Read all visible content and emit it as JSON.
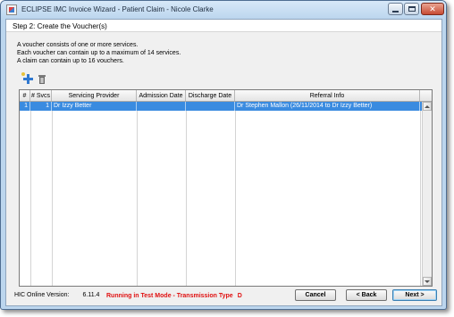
{
  "window": {
    "title": "ECLIPSE IMC Invoice Wizard - Patient Claim - Nicole Clarke",
    "controls": {
      "minimize": "minimize",
      "maximize": "maximize",
      "close": "close"
    }
  },
  "step": {
    "title": "Step 2: Create the Voucher(s)"
  },
  "description": [
    "A voucher consists of one or more services.",
    "Each voucher can contain up to a maximum of 14 services.",
    "A claim can contain up to 16 vouchers."
  ],
  "toolbar": {
    "add_icon": "add-plus-icon",
    "delete_icon": "trash-icon"
  },
  "grid": {
    "columns": [
      "#",
      "# Svcs",
      "Servicing Provider",
      "Admission Date",
      "Discharge Date",
      "Referral Info"
    ],
    "rows": [
      {
        "num": "1",
        "svcs": "1",
        "provider": "Dr Izzy Better",
        "admission": "",
        "discharge": "",
        "referral": "Dr Stephen Mallon (26/11/2014 to Dr Izzy Better)",
        "selected": true
      }
    ]
  },
  "footer": {
    "version_label": "HIC Online Version:",
    "version_value": "6.11.4",
    "test_mode": "Running in Test Mode - Transmission Type",
    "transmission_type": "D",
    "cancel_label": "Cancel",
    "back_label": "< Back",
    "next_label": "Next >"
  },
  "colors": {
    "selection": "#3a8be0",
    "test_mode_text": "#e01010"
  }
}
